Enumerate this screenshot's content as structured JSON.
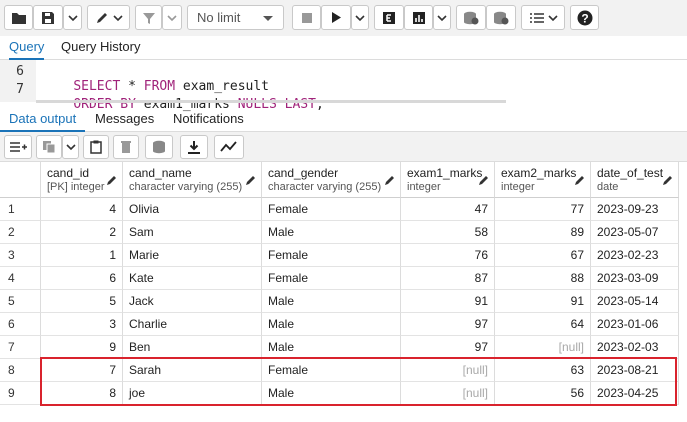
{
  "toolbar": {
    "limit_value": "No limit",
    "icons": [
      "folder-icon",
      "save-icon",
      "chevron-down-icon",
      "pencil-icon",
      "filter-icon",
      "stop-icon",
      "play-icon",
      "explain-icon",
      "explain-analyze-icon",
      "commit-icon",
      "rollback-icon",
      "macros-icon",
      "help-icon"
    ]
  },
  "query_tabs": [
    {
      "label": "Query",
      "active": true
    },
    {
      "label": "Query History",
      "active": false
    }
  ],
  "editor": {
    "lines": [
      {
        "number": "6",
        "tokens": [
          [
            "kw",
            "SELECT"
          ],
          [
            "id",
            " * "
          ],
          [
            "kw",
            "FROM"
          ],
          [
            "id",
            " exam_result"
          ]
        ]
      },
      {
        "number": "7",
        "tokens": [
          [
            "kw",
            "ORDER BY"
          ],
          [
            "id",
            " exam1_marks "
          ],
          [
            "kw",
            "NULLS LAST"
          ],
          [
            "id",
            ";"
          ]
        ]
      }
    ]
  },
  "output_tabs": [
    {
      "label": "Data output",
      "active": true
    },
    {
      "label": "Messages",
      "active": false
    },
    {
      "label": "Notifications",
      "active": false
    }
  ],
  "grid": {
    "columns": [
      {
        "name": "cand_id",
        "type": "[PK] integer",
        "align": "num"
      },
      {
        "name": "cand_name",
        "type": "character varying (255)",
        "align": "txt"
      },
      {
        "name": "cand_gender",
        "type": "character varying (255)",
        "align": "txt"
      },
      {
        "name": "exam1_marks",
        "type": "integer",
        "align": "num"
      },
      {
        "name": "exam2_marks",
        "type": "integer",
        "align": "num"
      },
      {
        "name": "date_of_test",
        "type": "date",
        "align": "txt"
      }
    ],
    "rows": [
      {
        "n": "1",
        "cells": [
          "4",
          "Olivia",
          "Female",
          "47",
          "77",
          "2023-09-23"
        ]
      },
      {
        "n": "2",
        "cells": [
          "2",
          "Sam",
          "Male",
          "58",
          "89",
          "2023-05-07"
        ]
      },
      {
        "n": "3",
        "cells": [
          "1",
          "Marie",
          "Female",
          "76",
          "67",
          "2023-02-23"
        ]
      },
      {
        "n": "4",
        "cells": [
          "6",
          "Kate",
          "Female",
          "87",
          "88",
          "2023-03-09"
        ]
      },
      {
        "n": "5",
        "cells": [
          "5",
          "Jack",
          "Male",
          "91",
          "91",
          "2023-05-14"
        ]
      },
      {
        "n": "6",
        "cells": [
          "3",
          "Charlie",
          "Male",
          "97",
          "64",
          "2023-01-06"
        ]
      },
      {
        "n": "7",
        "cells": [
          "9",
          "Ben",
          "Male",
          "97",
          "[null]",
          "2023-02-03"
        ]
      },
      {
        "n": "8",
        "cells": [
          "7",
          "Sarah",
          "Female",
          "[null]",
          "63",
          "2023-08-21"
        ]
      },
      {
        "n": "9",
        "cells": [
          "8",
          "joe",
          "Male",
          "[null]",
          "56",
          "2023-04-25"
        ]
      }
    ],
    "highlighted_rows": [
      "8",
      "9"
    ],
    "highlight_color": "#d9232d"
  },
  "colors": {
    "accent": "#1a73b8",
    "keyword": "#a0237a",
    "null_text": "#a8a8a8"
  }
}
